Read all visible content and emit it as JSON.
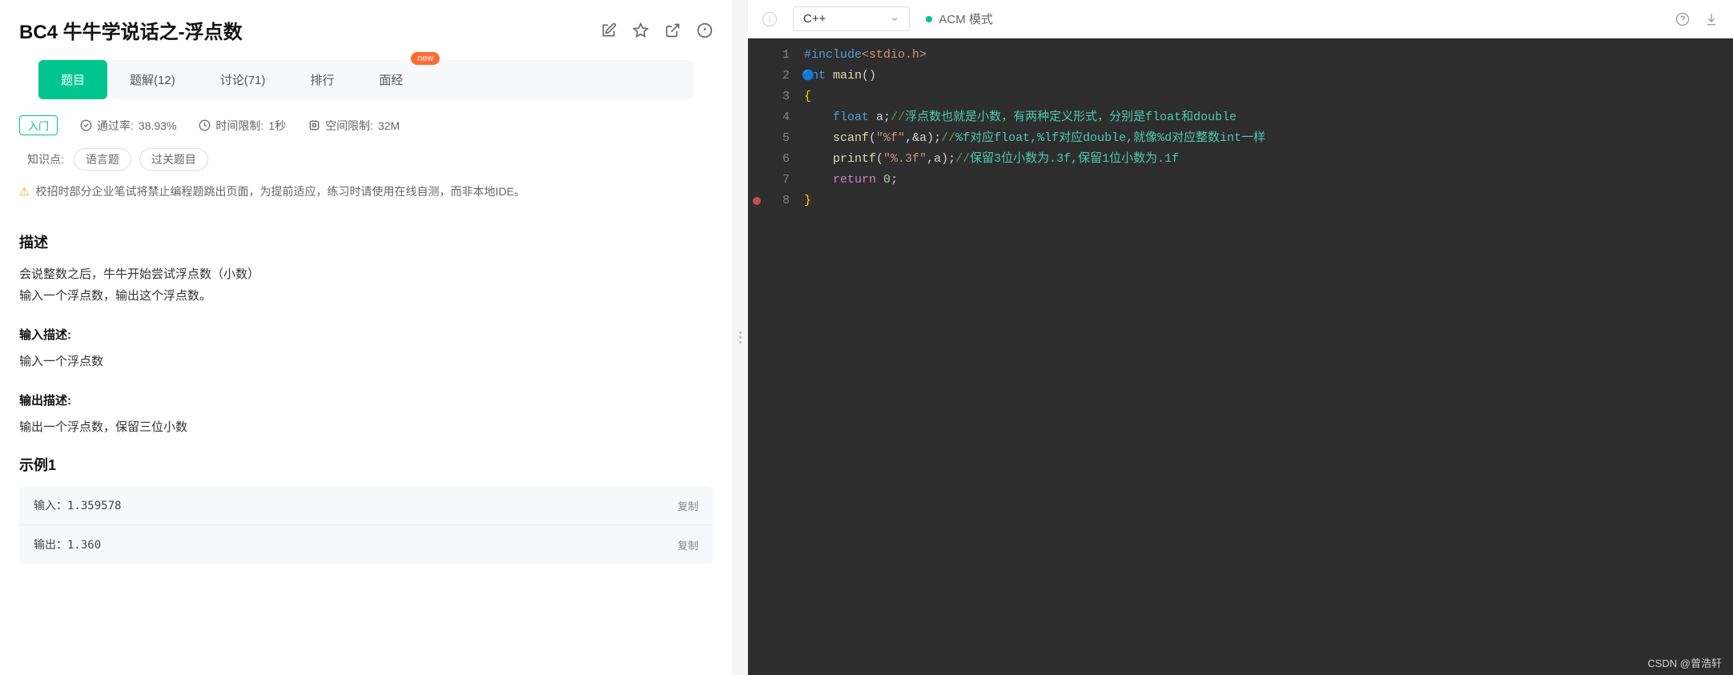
{
  "header": {
    "title": "BC4  牛牛学说话之-浮点数"
  },
  "tabs": [
    {
      "label": "题目",
      "active": true
    },
    {
      "label": "题解(12)"
    },
    {
      "label": "讨论(71)"
    },
    {
      "label": "排行"
    },
    {
      "label": "面经",
      "badge": "new"
    }
  ],
  "meta": {
    "level": "入门",
    "pass_label": "通过率:",
    "pass_value": "38.93%",
    "time_label": "时间限制:",
    "time_value": "1秒",
    "space_label": "空间限制:",
    "space_value": "32M"
  },
  "knowledge": {
    "label": "知识点:",
    "tags": [
      "语言题",
      "过关题目"
    ]
  },
  "warning": "校招时部分企业笔试将禁止编程题跳出页面，为提前适应，练习时请使用在线自测，而非本地IDE。",
  "sections": {
    "desc_title": "描述",
    "desc_lines": [
      "会说整数之后，牛牛开始尝试浮点数（小数）",
      "输入一个浮点数，输出这个浮点数。"
    ],
    "input_title": "输入描述:",
    "input_text": "输入一个浮点数",
    "output_title": "输出描述:",
    "output_text": "输出一个浮点数，保留三位小数",
    "example_title": "示例1",
    "example_in_label": "输入：",
    "example_in_value": "1.359578",
    "example_out_label": "输出：",
    "example_out_value": "1.360",
    "copy_label": "复制"
  },
  "editor": {
    "language": "C++",
    "mode": "ACM 模式",
    "gutter": [
      "1",
      "2",
      "3",
      "4",
      "5",
      "6",
      "7",
      "8"
    ],
    "breakpoint_line": 8,
    "code_tokens": [
      [
        {
          "c": "tk-inc",
          "t": "#include"
        },
        {
          "c": "tk-hdr",
          "t": "<stdio.h>"
        }
      ],
      [
        {
          "c": "tk-type",
          "t": "int"
        },
        {
          "t": " "
        },
        {
          "c": "tk-fn",
          "t": "main"
        },
        {
          "t": "()"
        }
      ],
      [
        {
          "c": "tk-brace",
          "t": "{"
        }
      ],
      [
        {
          "t": "    "
        },
        {
          "c": "tk-type",
          "t": "float"
        },
        {
          "t": " a;"
        },
        {
          "c": "tk-cmt",
          "t": "//"
        },
        {
          "c": "tk-cmt-cn",
          "t": "浮点数也就是小数，有两种定义形式，分别是float和double"
        }
      ],
      [
        {
          "t": "    "
        },
        {
          "c": "tk-fn",
          "t": "scanf"
        },
        {
          "t": "("
        },
        {
          "c": "tk-str",
          "t": "\"%f\""
        },
        {
          "t": ",&a);"
        },
        {
          "c": "tk-cmt",
          "t": "//"
        },
        {
          "c": "tk-cmt-cn",
          "t": "%f对应float,%lf对应double,就像%d对应整数int一样"
        }
      ],
      [
        {
          "t": "    "
        },
        {
          "c": "tk-fn",
          "t": "printf"
        },
        {
          "t": "("
        },
        {
          "c": "tk-str",
          "t": "\"%.3f\""
        },
        {
          "t": ",a);"
        },
        {
          "c": "tk-cmt",
          "t": "//"
        },
        {
          "c": "tk-cmt-cn",
          "t": "保留3位小数为.3f,保留1位小数为.1f"
        }
      ],
      [
        {
          "t": "    "
        },
        {
          "c": "tk-kw",
          "t": "return"
        },
        {
          "t": " "
        },
        {
          "c": "tk-num",
          "t": "0"
        },
        {
          "t": ";"
        }
      ],
      [
        {
          "c": "tk-brace",
          "t": "}"
        }
      ]
    ]
  },
  "watermark": "CSDN @曾浩轩"
}
